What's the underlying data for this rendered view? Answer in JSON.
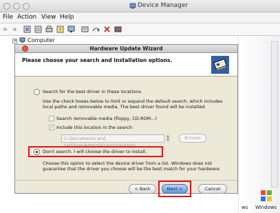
{
  "window": {
    "title": "Device Manager"
  },
  "menu": {
    "items": [
      "File",
      "Action",
      "View",
      "Help"
    ]
  },
  "tree": {
    "root_label": "Computer"
  },
  "right_strip": {
    "fragment_text": "ws",
    "windows_label": "Windows"
  },
  "wizard": {
    "title": "Hardware Update Wizard",
    "header_title": "Please choose your search and installation options.",
    "option_search": {
      "label": "Search for the best driver in these locations.",
      "description": "Use the check boxes below to limit or expand the default search, which includes local paths and removable media. The best driver found will be installed.",
      "check_removable_label": "Search removable media (floppy, CD-ROM...)",
      "check_include_label": "Include this location in the search:",
      "path_value": "C:\\Documents and Settings\\Administrator\\Desktop\\",
      "browse_label": "Browse"
    },
    "option_manual": {
      "label": "Don't search. I will choose the driver to install.",
      "description": "Choose this option to select the device driver from a list. Windows does not guarantee that the driver you choose will be the best match for your hardware."
    },
    "buttons": {
      "back": "< Back",
      "next": "Next >",
      "cancel": "Cancel"
    }
  },
  "colors": {
    "highlight": "#e0141b",
    "primary_button": "#5e95df",
    "dialog_bg": "#ece9d8"
  }
}
